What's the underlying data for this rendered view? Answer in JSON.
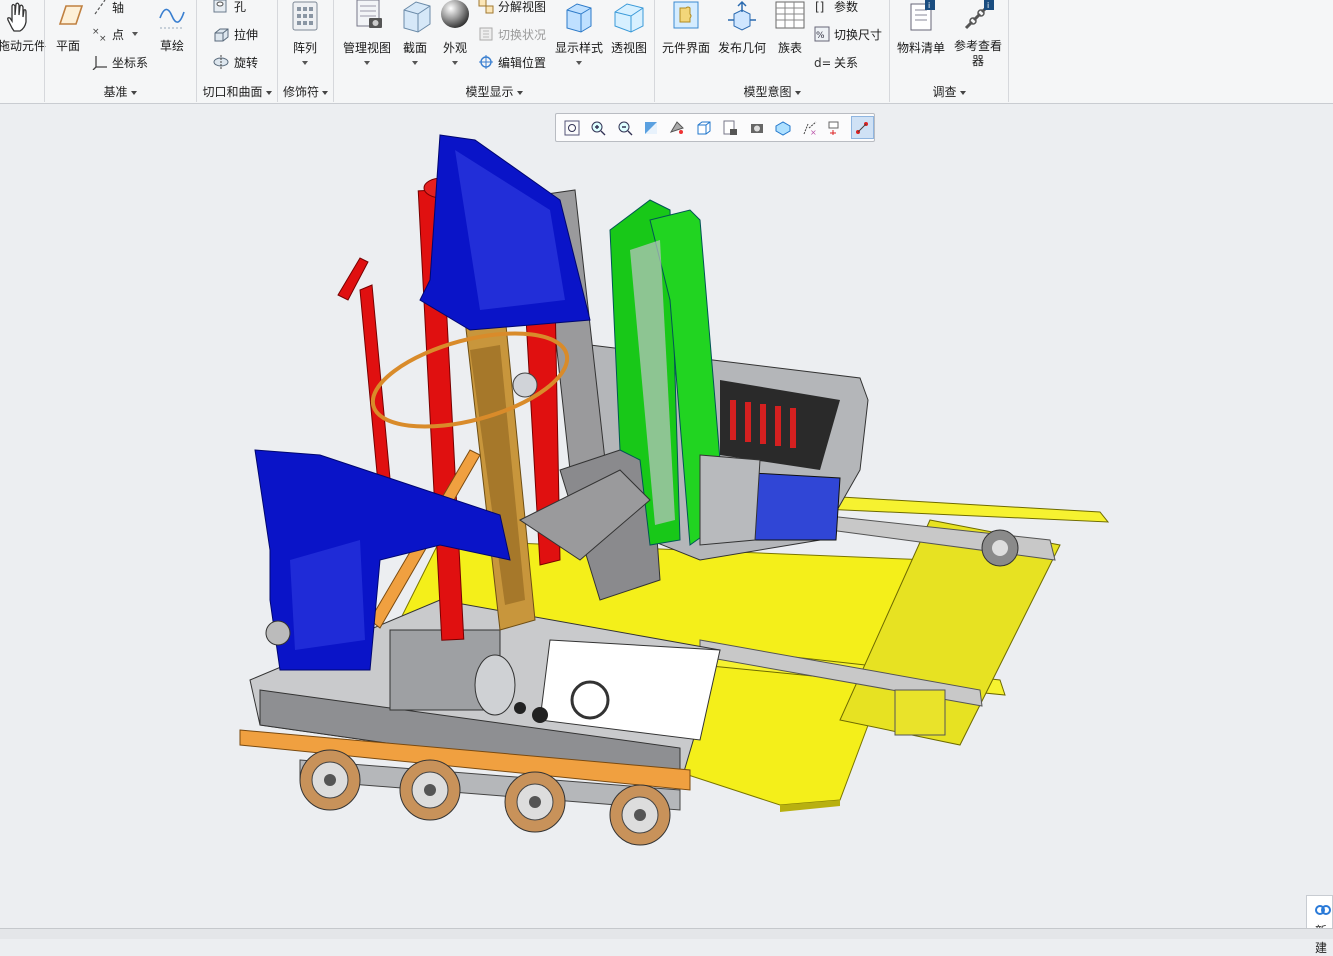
{
  "ribbon": {
    "drag_component": "拖动元件",
    "plane": "平面",
    "axis": "轴",
    "point": "点",
    "csys": "坐标系",
    "sketch": "草绘",
    "hole": "孔",
    "extrude": "拉伸",
    "revolve": "旋转",
    "pattern": "阵列",
    "manage_views": "管理视图",
    "section": "截面",
    "appearance": "外观",
    "explode_view": "分解视图",
    "toggle_status": "切换状况",
    "edit_position": "编辑位置",
    "display_style": "显示样式",
    "perspective": "透视图",
    "component_interface": "元件界面",
    "publish_geometry": "发布几何",
    "family_table": "族表",
    "parameters": "参数",
    "toggle_dimensions": "切换尺寸",
    "relations": "关系",
    "bom": "物料清单",
    "reference_viewer": "参考查看器",
    "groups": {
      "datum": "基准",
      "cut_surface": "切口和曲面",
      "modifiers": "修饰符",
      "model_display": "模型显示",
      "model_intent": "模型意图",
      "investigate": "调查"
    }
  },
  "view_toolbar": {
    "icons": [
      "refit-icon",
      "zoom-in-icon",
      "zoom-out-icon",
      "repaint-icon",
      "perspective-icon",
      "saved-orientations-icon",
      "view-manager-icon",
      "display-style-icon",
      "datum-display-icon",
      "annotation-display-icon",
      "spin-center-icon",
      "selection-filter-icon"
    ],
    "active_index": 11
  },
  "corner_panel": {
    "label": "新建"
  },
  "colors": {
    "ribbon_bg": "#f5f6f7",
    "viewport_bg": "#eceef1",
    "model_blue": "#0a14c8",
    "model_yellow": "#f4ef1a",
    "model_green": "#18c818",
    "model_red": "#e01010",
    "model_gold": "#c8963c",
    "model_gray": "#8c8c8c",
    "model_orange": "#f0a040"
  }
}
